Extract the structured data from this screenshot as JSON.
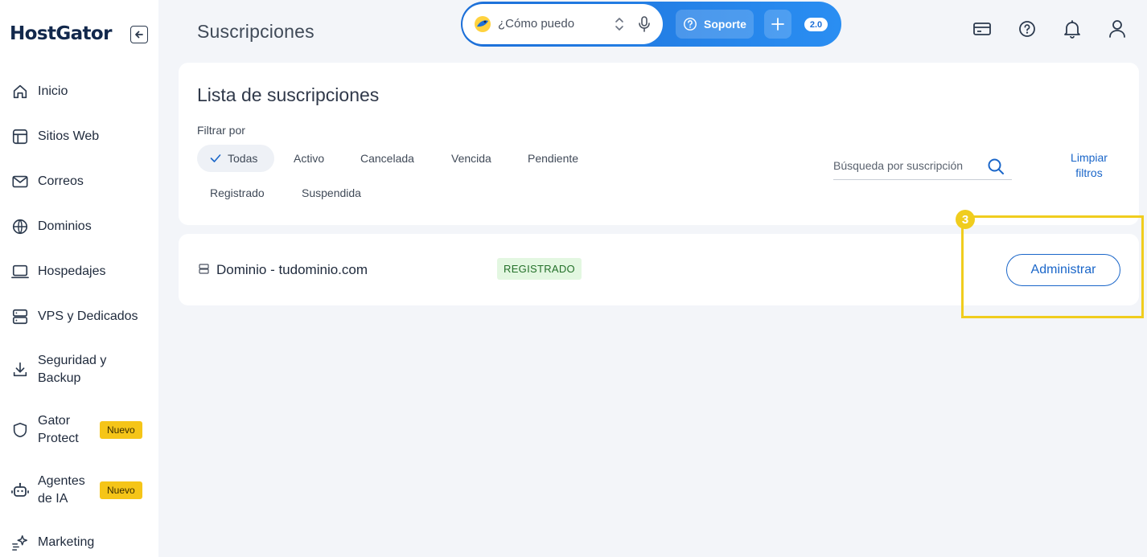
{
  "brand": {
    "logo_text": "HostGator"
  },
  "sidebar": {
    "items": [
      {
        "label": "Inicio",
        "icon": "home-icon"
      },
      {
        "label": "Sitios Web",
        "icon": "layout-icon"
      },
      {
        "label": "Correos",
        "icon": "mail-icon"
      },
      {
        "label": "Dominios",
        "icon": "globe-icon"
      },
      {
        "label": "Hospedajes",
        "icon": "laptop-icon"
      },
      {
        "label": "VPS y Dedicados",
        "icon": "server-icon"
      },
      {
        "label": "Seguridad y Backup",
        "icon": "download-icon"
      },
      {
        "label": "Gator Protect",
        "icon": "shield-icon",
        "badge": "Nuevo"
      },
      {
        "label": "Agentes de IA",
        "icon": "robot-icon",
        "badge": "Nuevo"
      },
      {
        "label": "Marketing",
        "icon": "sparkle-icon"
      }
    ]
  },
  "header": {
    "title": "Suscripciones",
    "assistant_placeholder": "¿Cómo puedo",
    "support_label": "Soporte",
    "version_badge": "2.0"
  },
  "filters": {
    "title": "Lista de suscripciones",
    "filter_label": "Filtrar por",
    "chips": [
      "Todas",
      "Activo",
      "Cancelada",
      "Vencida",
      "Pendiente",
      "Registrado",
      "Suspendida"
    ],
    "active_chip": "Todas",
    "search_placeholder": "Búsqueda por suscripción",
    "clear_label_line1": "Limpiar",
    "clear_label_line2": "filtros"
  },
  "subscriptions": [
    {
      "name": "Dominio - tudominio.com",
      "status": "REGISTRADO",
      "action": "Administrar"
    }
  ],
  "annotation": {
    "step": "3",
    "color": "#f0cd1e"
  },
  "colors": {
    "brand_navy": "#12284c",
    "accent_blue": "#1a66c9",
    "status_green_bg": "#e3f7e1",
    "highlight_yellow": "#f0cd1e"
  }
}
